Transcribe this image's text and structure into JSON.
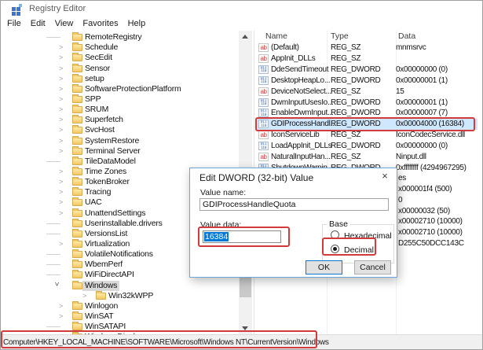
{
  "window": {
    "title": "Registry Editor",
    "menu": [
      "File",
      "Edit",
      "View",
      "Favorites",
      "Help"
    ]
  },
  "tree": {
    "items": [
      {
        "label": "RemoteRegistry",
        "state": "leaf",
        "depth": 0
      },
      {
        "label": "Schedule",
        "state": "collapsed",
        "depth": 0
      },
      {
        "label": "SecEdit",
        "state": "collapsed",
        "depth": 0
      },
      {
        "label": "Sensor",
        "state": "collapsed",
        "depth": 0
      },
      {
        "label": "setup",
        "state": "collapsed",
        "depth": 0
      },
      {
        "label": "SoftwareProtectionPlatform",
        "state": "collapsed",
        "depth": 0
      },
      {
        "label": "SPP",
        "state": "collapsed",
        "depth": 0
      },
      {
        "label": "SRUM",
        "state": "collapsed",
        "depth": 0
      },
      {
        "label": "Superfetch",
        "state": "collapsed",
        "depth": 0
      },
      {
        "label": "SvcHost",
        "state": "collapsed",
        "depth": 0
      },
      {
        "label": "SystemRestore",
        "state": "collapsed",
        "depth": 0
      },
      {
        "label": "Terminal Server",
        "state": "collapsed",
        "depth": 0
      },
      {
        "label": "TileDataModel",
        "state": "leaf",
        "depth": 0
      },
      {
        "label": "Time Zones",
        "state": "collapsed",
        "depth": 0
      },
      {
        "label": "TokenBroker",
        "state": "collapsed",
        "depth": 0
      },
      {
        "label": "Tracing",
        "state": "collapsed",
        "depth": 0
      },
      {
        "label": "UAC",
        "state": "collapsed",
        "depth": 0
      },
      {
        "label": "UnattendSettings",
        "state": "collapsed",
        "depth": 0
      },
      {
        "label": "Userinstallable.drivers",
        "state": "leaf",
        "depth": 0
      },
      {
        "label": "VersionsList",
        "state": "leaf",
        "depth": 0
      },
      {
        "label": "Virtualization",
        "state": "collapsed",
        "depth": 0
      },
      {
        "label": "VolatileNotifications",
        "state": "leaf",
        "depth": 0
      },
      {
        "label": "WbemPerf",
        "state": "leaf",
        "depth": 0
      },
      {
        "label": "WiFiDirectAPI",
        "state": "leaf",
        "depth": 0
      },
      {
        "label": "Windows",
        "state": "expanded",
        "depth": 0,
        "selected": true
      },
      {
        "label": "Win32kWPP",
        "state": "collapsed",
        "depth": 1
      },
      {
        "label": "Winlogon",
        "state": "collapsed",
        "depth": 0
      },
      {
        "label": "WinSAT",
        "state": "collapsed",
        "depth": 0
      },
      {
        "label": "WinSATAPI",
        "state": "leaf",
        "depth": 0
      },
      {
        "label": "Wireless Display",
        "state": "leaf",
        "depth": 0
      }
    ]
  },
  "list": {
    "columns": [
      "Name",
      "Type",
      "Data"
    ],
    "rows": [
      {
        "icon": "sz",
        "name": "(Default)",
        "type": "REG_SZ",
        "data": "mnmsrvc"
      },
      {
        "icon": "sz",
        "name": "AppInit_DLLs",
        "type": "REG_SZ",
        "data": ""
      },
      {
        "icon": "dword",
        "name": "DdeSendTimeout",
        "type": "REG_DWORD",
        "data": "0x00000000 (0)"
      },
      {
        "icon": "dword",
        "name": "DesktopHeapLo...",
        "type": "REG_DWORD",
        "data": "0x00000001 (1)"
      },
      {
        "icon": "sz",
        "name": "DeviceNotSelect...",
        "type": "REG_SZ",
        "data": "15"
      },
      {
        "icon": "dword",
        "name": "DwmInputUsesIo...",
        "type": "REG_DWORD",
        "data": "0x00000001 (1)"
      },
      {
        "icon": "dword",
        "name": "EnableDwmInput...",
        "type": "REG_DWORD",
        "data": "0x00000007 (7)"
      },
      {
        "icon": "dword",
        "name": "GDIProcessHandl...",
        "type": "REG_DWORD",
        "data": "0x00004000 (16384)",
        "selected": true
      },
      {
        "icon": "sz",
        "name": "IconServiceLib",
        "type": "REG_SZ",
        "data": "IconCodecService.dll"
      },
      {
        "icon": "dword",
        "name": "LoadAppInit_DLLs",
        "type": "REG_DWORD",
        "data": "0x00000000 (0)"
      },
      {
        "icon": "sz",
        "name": "NaturalInputHan...",
        "type": "REG_SZ",
        "data": "Ninput.dll"
      },
      {
        "icon": "dword",
        "name": "ShutdownWarnin...",
        "type": "REG_DWORD",
        "data": "0xffffffff (4294967295)"
      }
    ],
    "partial_data_fragments": [
      "es",
      "x000001f4 (500)",
      "0",
      "x00000032 (50)",
      "x00002710 (10000)",
      "x00002710 (10000)",
      "D255C50DCC143C"
    ]
  },
  "dialog": {
    "title": "Edit DWORD (32-bit) Value",
    "close_glyph": "×",
    "value_name_label": "Value name:",
    "value_name": "GDIProcessHandleQuota",
    "value_data_label": "Value data:",
    "value_data": "16384",
    "base_label": "Base",
    "radio_hex_label": "Hexadecimal",
    "radio_dec_label": "Decimal",
    "radio_selected": "Decimal",
    "ok_label": "OK",
    "cancel_label": "Cancel"
  },
  "status_bar": {
    "path": "Computer\\HKEY_LOCAL_MACHINE\\SOFTWARE\\Microsoft\\Windows NT\\CurrentVersion\\Windows"
  },
  "colors": {
    "annotation_red": "#d13b3b",
    "selection_blue": "#0078d7",
    "row_selected_bg": "#cfe8ff",
    "tree_selected_bg": "#d9d9d9",
    "folder_yellow": "#f1c964"
  },
  "icons": {
    "app": "registry-grid",
    "reg_sz": "ab",
    "reg_dword": "binary-digits",
    "tree_key": "folder"
  }
}
